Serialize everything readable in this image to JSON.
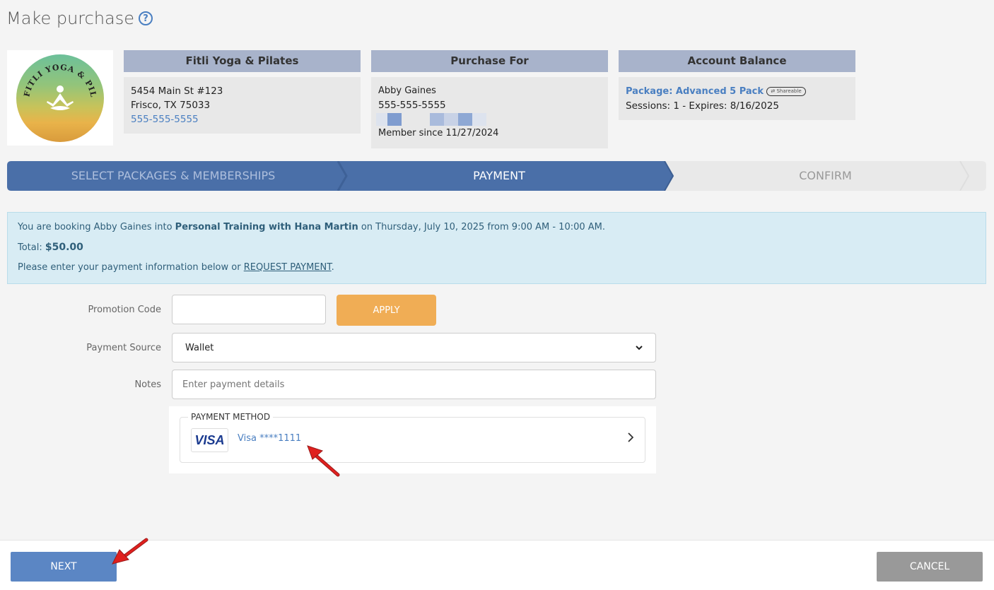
{
  "page": {
    "title": "Make purchase"
  },
  "studio": {
    "name": "Fitli Yoga & Pilates",
    "address_line1": "5454 Main St #123",
    "address_line2": "Frisco, TX 75033",
    "phone": "555-555-5555",
    "logo_text": "FITLI YOGA & PILATES"
  },
  "purchase_for": {
    "header": "Purchase For",
    "name": "Abby Gaines",
    "phone": "555-555-5555",
    "member_since": "Member since 11/27/2024"
  },
  "account_balance": {
    "header": "Account Balance",
    "package": "Package: Advanced 5 Pack",
    "badge": "Shareable",
    "sessions": "Sessions: 1 -  Expires: 8/16/2025"
  },
  "steps": [
    {
      "label": "SELECT PACKAGES & MEMBERSHIPS",
      "state": "done"
    },
    {
      "label": "PAYMENT",
      "state": "active"
    },
    {
      "label": "CONFIRM",
      "state": "pending"
    }
  ],
  "alert": {
    "line1_prefix": "You are booking Abby Gaines into ",
    "line1_class": "Personal Training with Hana Martin",
    "line1_suffix": " on Thursday, July 10, 2025 from 9:00 AM - 10:00 AM.",
    "total_label": "Total: ",
    "total_value": "$50.00",
    "line3_prefix": "Please enter your payment information below or ",
    "line3_link": "REQUEST PAYMENT",
    "line3_suffix": "."
  },
  "form": {
    "promo_label": "Promotion Code",
    "promo_value": "",
    "apply_label": "APPLY",
    "source_label": "Payment Source",
    "source_value": "Wallet",
    "notes_label": "Notes",
    "notes_placeholder": "Enter payment details"
  },
  "payment_method": {
    "label": "PAYMENT METHOD",
    "brand": "VISA",
    "card": "Visa ****1111"
  },
  "footer": {
    "next_label": "NEXT",
    "cancel_label": "CANCEL"
  },
  "colors": {
    "accent": "#4a6fa8",
    "apply": "#f0ad55",
    "next": "#5b86c4",
    "cancel": "#999999"
  }
}
